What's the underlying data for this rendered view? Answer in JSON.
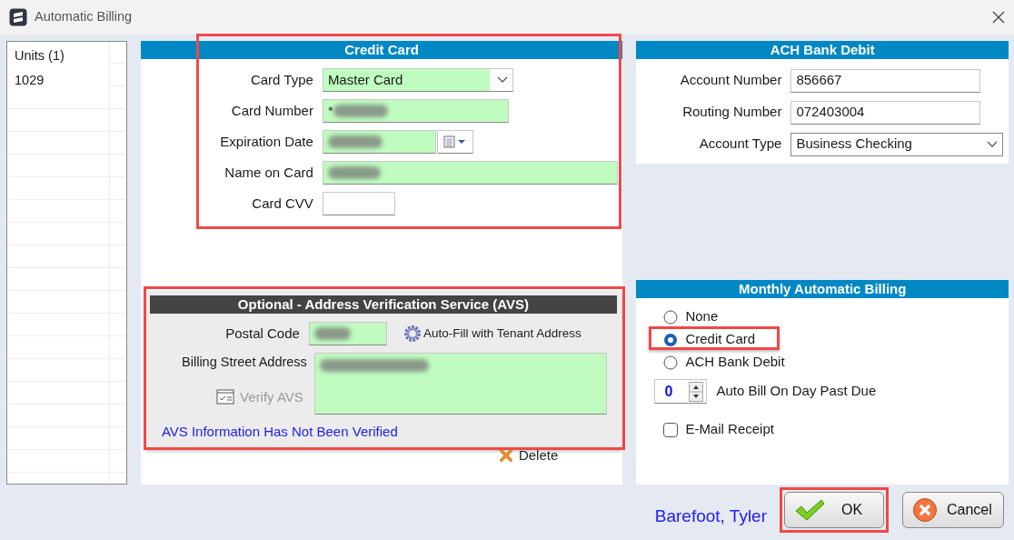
{
  "window": {
    "title": "Automatic Billing"
  },
  "units_list": {
    "header": "Units (1)",
    "items": [
      "1029"
    ]
  },
  "credit_card": {
    "title": "Credit Card",
    "highlighted": true,
    "fields": [
      {
        "kind": "select",
        "label": "Card Type",
        "value": "Master Card",
        "valid": true
      },
      {
        "kind": "text",
        "label": "Card Number",
        "value": "*",
        "valid": true,
        "redacted": true
      },
      {
        "kind": "date",
        "label": "Expiration Date",
        "valid": true,
        "redacted": true
      },
      {
        "kind": "text",
        "label": "Name on Card",
        "valid": true,
        "redacted": true
      },
      {
        "kind": "short",
        "label": "Card CVV",
        "valid": false
      }
    ]
  },
  "avs": {
    "title": "Optional - Address Verification Service (AVS)",
    "highlighted": true,
    "postal_code": {
      "label": "Postal Code",
      "valid": true,
      "redacted": true
    },
    "autofill_link": "Auto-Fill with Tenant Address",
    "street": {
      "label": "Billing Street Address",
      "valid": true,
      "redacted": true
    },
    "verify_button": {
      "label": "Verify AVS",
      "disabled": true
    },
    "status": "AVS Information Has Not Been Verified"
  },
  "delete_button": "Delete",
  "ach": {
    "title": "ACH Bank Debit",
    "fields": [
      {
        "kind": "text",
        "label": "Account Number",
        "value": "856667"
      },
      {
        "kind": "text",
        "label": "Routing Number",
        "value": "072403004"
      },
      {
        "kind": "select",
        "label": "Account Type",
        "value": "Business Checking"
      }
    ]
  },
  "monthly": {
    "title": "Monthly Automatic Billing",
    "options": [
      {
        "label": "None",
        "selected": false,
        "highlighted": false
      },
      {
        "label": "Credit Card",
        "selected": true,
        "highlighted": true
      },
      {
        "label": "ACH Bank Debit",
        "selected": false,
        "highlighted": false
      }
    ],
    "day_past_due": {
      "value": "0",
      "label": "Auto Bill On Day Past Due"
    },
    "email_receipt": {
      "label": "E-Mail Receipt",
      "checked": false
    }
  },
  "tenant_name": "Barefoot, Tyler",
  "buttons": [
    {
      "kind": "ok",
      "label": "OK",
      "highlighted": true
    },
    {
      "kind": "cancel",
      "label": "Cancel",
      "highlighted": false
    }
  ]
}
